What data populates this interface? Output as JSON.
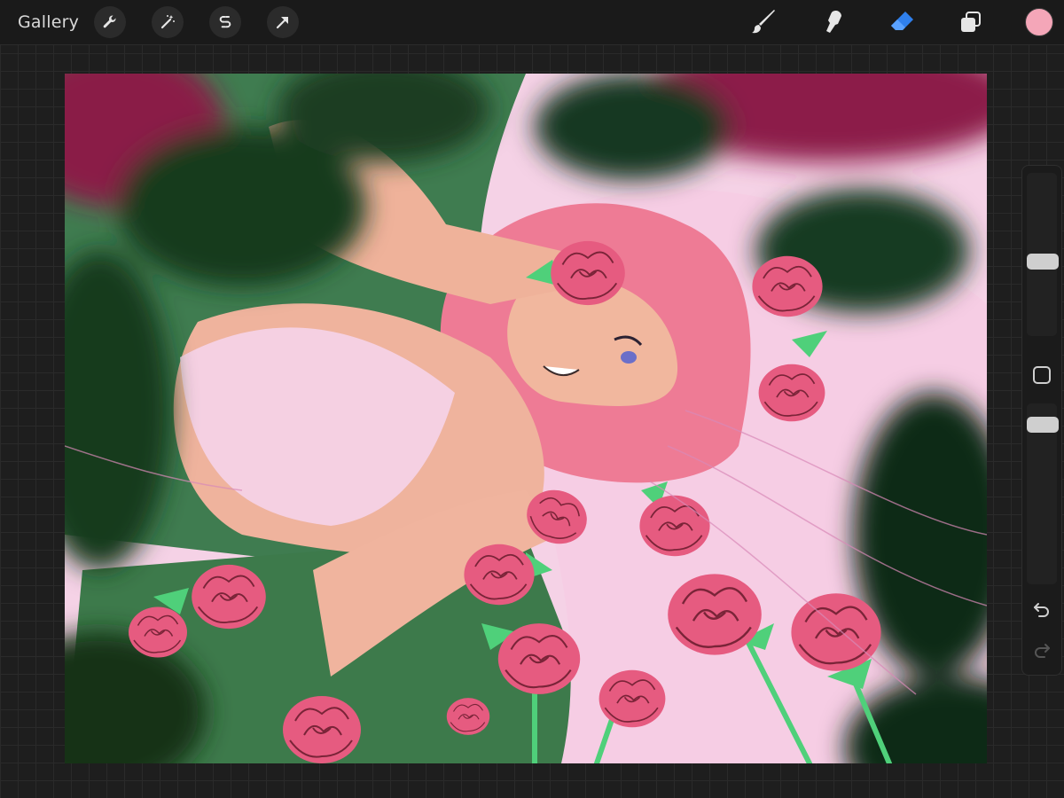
{
  "toolbar": {
    "gallery_label": "Gallery",
    "left_tools": [
      "wrench-icon",
      "magic-wand-icon",
      "selection-s-icon",
      "arrow-transform-icon"
    ],
    "right_tools": [
      "brush-icon",
      "smudge-icon",
      "eraser-icon",
      "layers-icon"
    ],
    "active_tool": "eraser-icon",
    "active_color": "#f4a6b8",
    "accent": "#2f80ed"
  },
  "canvas": {
    "description_colors": {
      "background_pink": "#f5d2e6",
      "leaf_green": "#3d7a4b",
      "rose_pink": "#e65b80",
      "skin": "#f1b79e",
      "hair": "#ee7b95"
    }
  },
  "sidebar": {
    "brush_size_level": 0.45,
    "opacity_level": 0.92,
    "undo_icon": "undo-icon",
    "redo_icon": "redo-icon"
  }
}
